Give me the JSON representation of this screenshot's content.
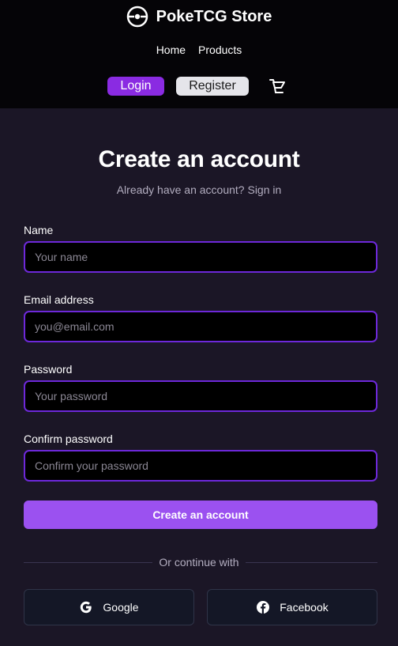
{
  "header": {
    "brand": "PokeTCG Store",
    "nav": [
      {
        "label": "Home"
      },
      {
        "label": "Products"
      }
    ],
    "login_label": "Login",
    "register_label": "Register",
    "cart_icon": "cart-icon"
  },
  "form": {
    "title": "Create an account",
    "subtitle": "Already have an account? Sign in",
    "fields": [
      {
        "label": "Name",
        "placeholder": "Your name",
        "value": ""
      },
      {
        "label": "Email address",
        "placeholder": "you@email.com",
        "value": ""
      },
      {
        "label": "Password",
        "placeholder": "Your password",
        "value": ""
      },
      {
        "label": "Confirm password",
        "placeholder": "Confirm your password",
        "value": ""
      }
    ],
    "submit_label": "Create an account",
    "divider": "Or continue with",
    "social": [
      {
        "label": "Google",
        "icon": "google-icon"
      },
      {
        "label": "Facebook",
        "icon": "facebook-icon"
      }
    ]
  },
  "colors": {
    "accent": "#8a2be2",
    "submit": "#9b51f0",
    "input_border": "#6d28d9",
    "background": "#1b1626",
    "header_bg": "#050407"
  }
}
